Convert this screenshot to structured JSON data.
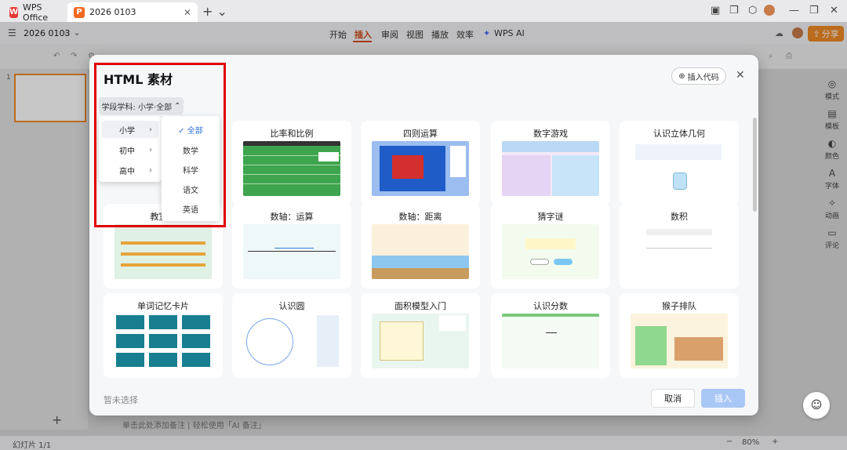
{
  "window": {
    "tabs": [
      {
        "label": "WPS Office"
      },
      {
        "label": "2026 0103"
      }
    ]
  },
  "app_bar": {
    "doc_name": "2026 0103",
    "menus": [
      "开始",
      "插入",
      "审阅",
      "视图",
      "播放",
      "效率",
      "WPS AI"
    ],
    "active_menu": "插入",
    "share_label": "分享"
  },
  "right_rail": [
    "模式",
    "模板",
    "颜色",
    "字体",
    "动画",
    "评论"
  ],
  "thumbs": {
    "index": "1"
  },
  "status": {
    "slide_count": "幻灯片 1/1",
    "zoom": "80%",
    "placeholder": "单击此处添加备注  |  轻松使用「AI 备注」"
  },
  "dialog": {
    "title": "HTML 素材",
    "insert_code": "插入代码",
    "filter_label": "学段学科: 小学·全部",
    "cards": [
      {
        "title": "比率和比例"
      },
      {
        "title": "四则运算"
      },
      {
        "title": "数字游戏"
      },
      {
        "title": "认识立体几何"
      },
      {
        "title": "教室分"
      },
      {
        "title": "数轴：运算"
      },
      {
        "title": "数轴：距离"
      },
      {
        "title": "猜字谜"
      },
      {
        "title": "数积"
      },
      {
        "title": "单词记忆卡片"
      },
      {
        "title": "认识圆"
      },
      {
        "title": "面积模型入门"
      },
      {
        "title": "认识分数"
      },
      {
        "title": "猴子排队"
      }
    ],
    "footer_hint": "暂未选择",
    "cancel_label": "取消",
    "insert_label": "插入"
  },
  "dropdown": {
    "levels": [
      "小学",
      "初中",
      "高中"
    ],
    "subjects": [
      "全部",
      "数学",
      "科学",
      "语文",
      "英语"
    ],
    "selected_level": "小学",
    "selected_subject": "全部"
  },
  "colors": {
    "accent": "#d04a1c",
    "highlight": "#e00000",
    "primary_btn": "#a9c7f5"
  }
}
